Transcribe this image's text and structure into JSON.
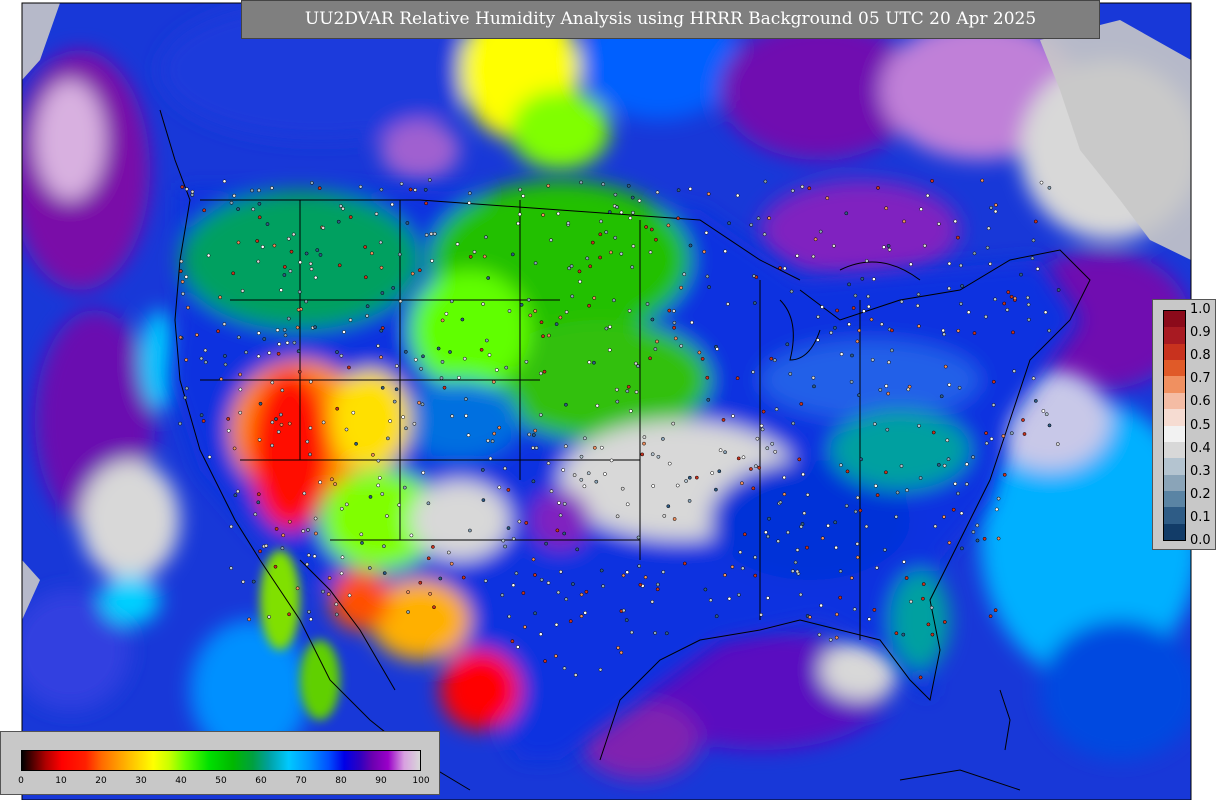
{
  "title": "UU2DVAR Relative Humidity Analysis using HRRR Background 05 UTC 20 Apr 2025",
  "legend": {
    "labels": [
      "1.0",
      "0.9",
      "0.8",
      "0.7",
      "0.6",
      "0.5",
      "0.4",
      "0.3",
      "0.2",
      "0.1",
      "0.0"
    ],
    "colors": [
      "#8b0a1a",
      "#a81a22",
      "#c8321e",
      "#e05a28",
      "#f09060",
      "#f4bca4",
      "#f6dcd2",
      "#f2f2f2",
      "#d8d8d8",
      "#b4c4d0",
      "#8aa4b8",
      "#5a84a4",
      "#2e5c86",
      "#123c68"
    ]
  },
  "colorbar": {
    "ticks": [
      "0",
      "10",
      "20",
      "30",
      "40",
      "50",
      "60",
      "70",
      "80",
      "90",
      "100"
    ]
  },
  "map": {
    "ocean_color": "#1a2fd0",
    "land_dry_color": "#ff2000",
    "land_moist_color": "#00c000",
    "saturated_color": "#d8d8d8",
    "foreign_land_color": "#c8c8c8"
  }
}
